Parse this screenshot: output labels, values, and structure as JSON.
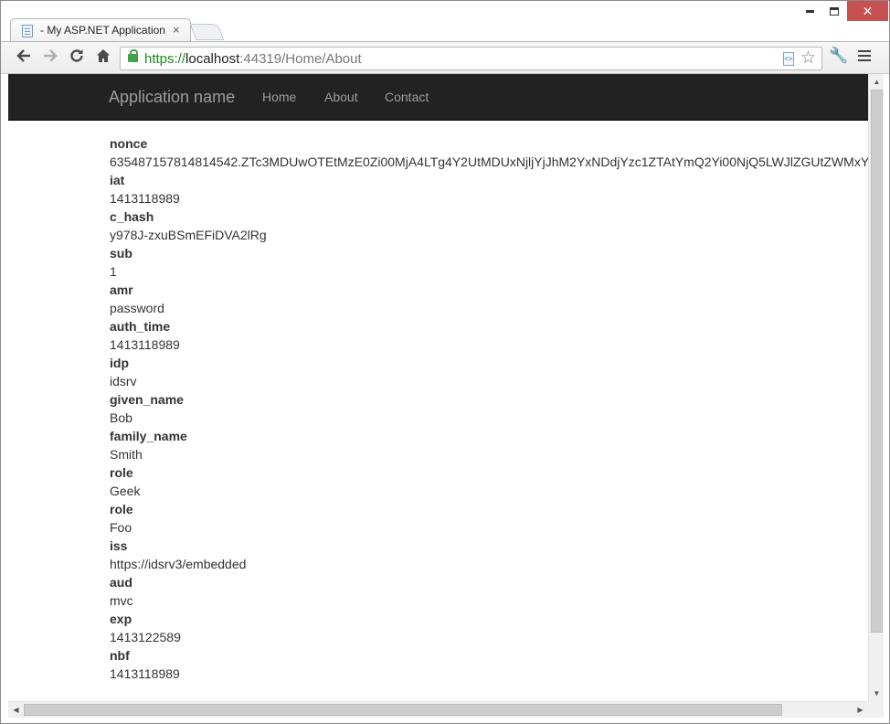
{
  "browser": {
    "tab_title": "- My ASP.NET Application",
    "tab_close": "×",
    "url_scheme": "https://",
    "url_host": "localhost",
    "url_rest": ":44319/Home/About",
    "icons": {
      "back": "back-arrow-icon",
      "forward": "forward-arrow-icon",
      "reload": "reload-icon",
      "home": "home-icon",
      "lock": "lock-icon",
      "page": "page-icon",
      "star": "star-icon",
      "wrench": "wrench-icon",
      "menu": "menu-icon"
    }
  },
  "navbar": {
    "brand": "Application name",
    "links": [
      "Home",
      "About",
      "Contact"
    ]
  },
  "claims": [
    {
      "type": "nonce",
      "value": "635487157814814542.ZTc3MDUwOTEtMzE0Zi00MjA4LTg4Y2UtMDUxNjljYjJhM2YxNDdjYzc1ZTAtYmQ2Yi00NjQ5LWJlZGUtZWMxY"
    },
    {
      "type": "iat",
      "value": "1413118989"
    },
    {
      "type": "c_hash",
      "value": "y978J-zxuBSmEFiDVA2lRg"
    },
    {
      "type": "sub",
      "value": "1"
    },
    {
      "type": "amr",
      "value": "password"
    },
    {
      "type": "auth_time",
      "value": "1413118989"
    },
    {
      "type": "idp",
      "value": "idsrv"
    },
    {
      "type": "given_name",
      "value": "Bob"
    },
    {
      "type": "family_name",
      "value": "Smith"
    },
    {
      "type": "role",
      "value": "Geek"
    },
    {
      "type": "role",
      "value": "Foo"
    },
    {
      "type": "iss",
      "value": "https://idsrv3/embedded"
    },
    {
      "type": "aud",
      "value": "mvc"
    },
    {
      "type": "exp",
      "value": "1413122589"
    },
    {
      "type": "nbf",
      "value": "1413118989"
    }
  ],
  "colors": {
    "navbar_bg": "#222222",
    "navbar_text": "#9d9d9d",
    "https_green": "#1c8a1c",
    "close_button": "#c75050"
  }
}
